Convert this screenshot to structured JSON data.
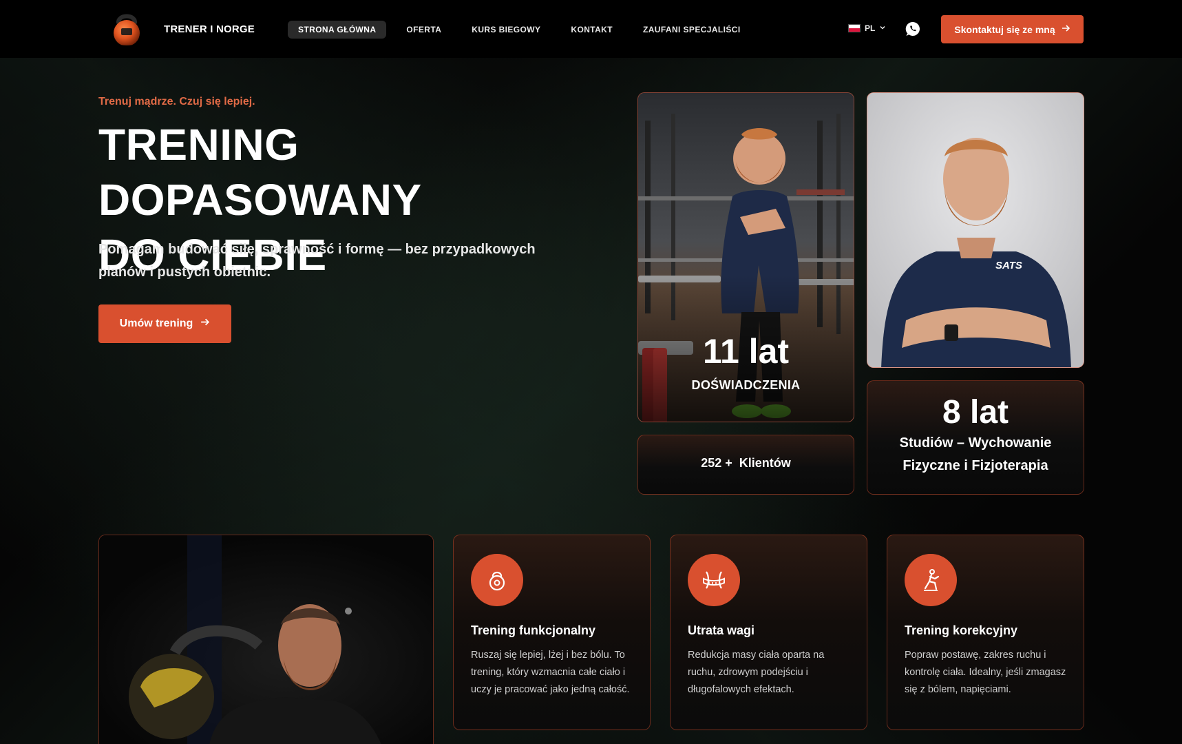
{
  "header": {
    "brand": "TRENER I NORGE",
    "nav": [
      "STRONA GŁÓWNA",
      "OFERTA",
      "KURS BIEGOWY",
      "KONTAKT",
      "ZAUFANI SPECJALIŚCI"
    ],
    "active_nav": "STRONA GŁÓWNA",
    "language": "PL",
    "cta_label": "Skontaktuj się ze mną"
  },
  "hero": {
    "tagline": "Trenuj mądrze. Czuj się lepiej.",
    "headline_line1": "TRENING DOPASOWANY",
    "headline_line2": "DO CIEBIE",
    "subtitle": "Pomagam budować siłę, sprawność i formę — bez przypadkowych planów i pustych obietnic.",
    "cta_label": "Umów trening"
  },
  "stats": {
    "experience_value": "11 lat",
    "experience_label": "DOŚWIADCZENIA",
    "shirt_logo": "SATS",
    "clients_value": "252 +",
    "clients_label": "Klientów",
    "studies_value": "8 lat",
    "studies_line1": "Studiów – Wychowanie",
    "studies_line2": "Fizyczne i Fizjoterapia"
  },
  "services": [
    {
      "title": "Trening funkcjonalny",
      "description": "Ruszaj się lepiej, lżej i bez bólu. To trening, który wzmacnia całe ciało i uczy je pracować jako jedną całość.",
      "icon": "kettlebell-icon"
    },
    {
      "title": "Utrata wagi",
      "description": "Redukcja masy ciała oparta na ruchu, zdrowym podejściu i długofalowych efektach.",
      "icon": "waist-measure-icon"
    },
    {
      "title": "Trening korekcyjny",
      "description": "Popraw postawę, zakres ruchu i kontrolę ciała. Idealny, jeśli zmagasz się z bólem, napięciami.",
      "icon": "stretching-person-icon"
    }
  ],
  "colors": {
    "accent": "#d9502f",
    "background": "#050505"
  }
}
